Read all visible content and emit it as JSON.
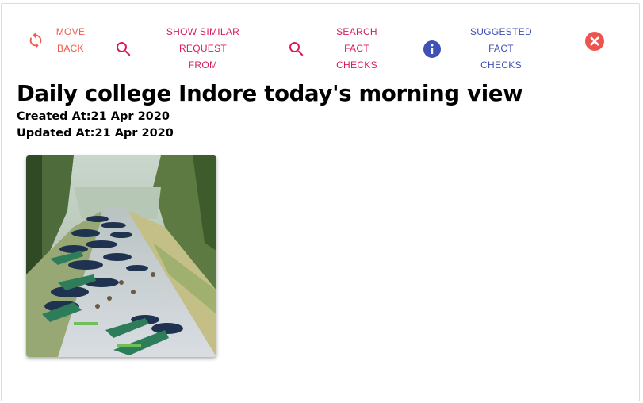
{
  "toolbar": {
    "move_back": {
      "label_line1": "MOVE",
      "label_line2": "BACK",
      "icon": "refresh-icon",
      "color": "#ef5a4c"
    },
    "similar": {
      "label_line1": "SHOW SIMILAR REQUEST",
      "label_line2": "FROM",
      "icon": "search-icon",
      "color": "#d81b60"
    },
    "search_fact": {
      "label_line1": "SEARCH FACT",
      "label_line2": "CHECKS",
      "icon": "search-icon",
      "color": "#d81b60"
    },
    "suggested": {
      "label_line1": "SUGGESTED FACT",
      "label_line2": "CHECKS",
      "icon": "info-icon",
      "color": "#3f51b5"
    },
    "close": {
      "icon": "close-circle-icon",
      "color": "#ef5350"
    }
  },
  "post": {
    "title": "Daily college Indore today's morning view",
    "created": "Created At:21 Apr 2020",
    "updated": "Updated At:21 Apr 2020"
  }
}
